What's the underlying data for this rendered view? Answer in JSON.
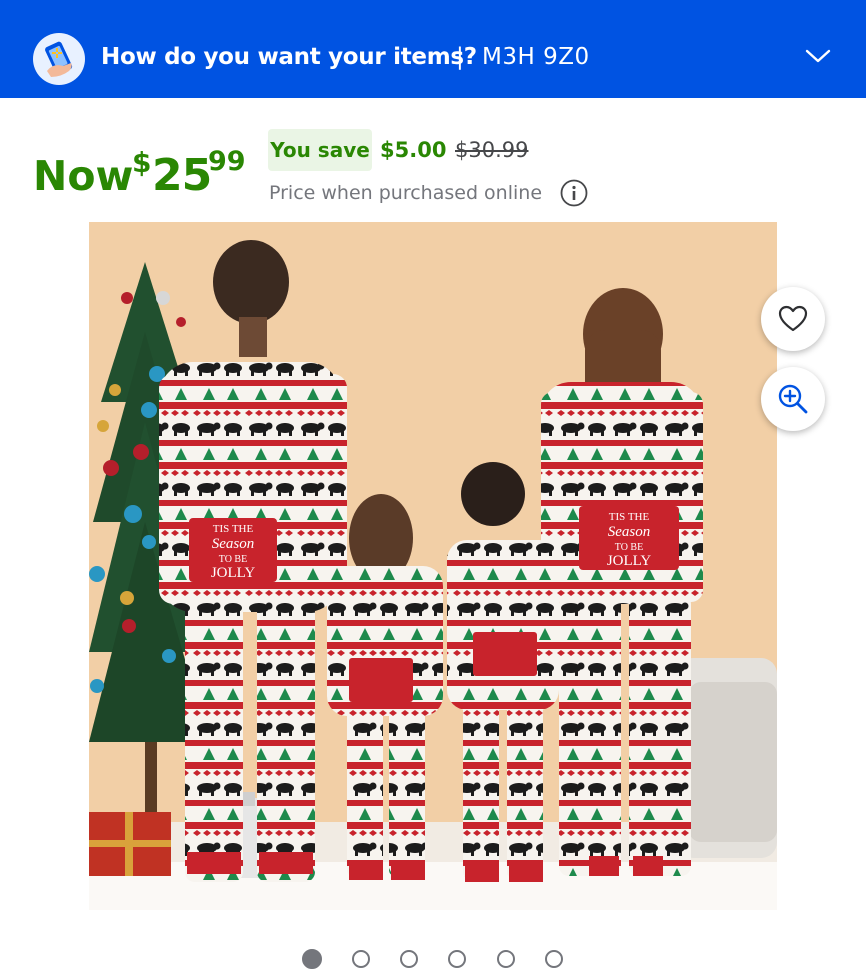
{
  "header": {
    "title": "How do you want your items?",
    "separator": "|",
    "postal_code": "M3H 9Z0",
    "icons": [
      "walmart-app-icon",
      "chevron-down-icon"
    ],
    "background_color": "#0053e2"
  },
  "price": {
    "now_label": "Now",
    "currency_symbol": "$",
    "dollars": "25",
    "cents": "99",
    "you_save_label": "You save",
    "save_amount": "$5.00",
    "was_price": "$30.99",
    "note": "Price when purchased online",
    "accent_color": "#2a8703"
  },
  "product_image": {
    "print_text": [
      "TIS THE",
      "Season",
      "TO BE",
      "JOLLY"
    ]
  },
  "actions": {
    "favorite_icon": "heart-icon",
    "zoom_icon": "zoom-in-icon"
  },
  "carousel": {
    "total": 6,
    "active_index": 0
  }
}
